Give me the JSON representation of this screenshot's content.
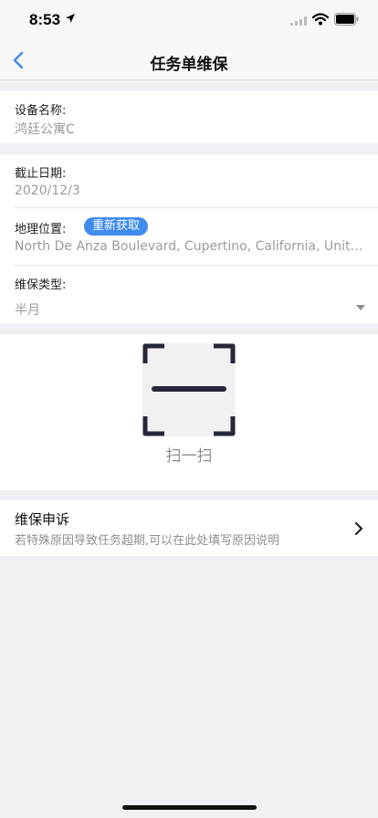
{
  "status_bar": {
    "time": "8:53",
    "icons": [
      "location-arrow-icon",
      "signal-icon",
      "wifi-icon",
      "battery-icon"
    ]
  },
  "nav": {
    "title": "任务单维保",
    "back_icon": "chevron-left-icon"
  },
  "device": {
    "label": "设备名称:",
    "value": "鸿廷公寓C"
  },
  "deadline": {
    "label": "截止日期:",
    "value": "2020/12/3"
  },
  "location": {
    "label": "地理位置:",
    "refresh_label": "重新获取",
    "value": "North De Anza Boulevard, Cupertino, California, United S..."
  },
  "maintenance_type": {
    "label": "维保类型:",
    "value": "半月",
    "icon": "caret-down-icon"
  },
  "scan": {
    "label": "扫一扫",
    "icon": "scan-frame-icon"
  },
  "appeal": {
    "title": "维保申诉",
    "description": "若特殊原因导致任务超期,可以在此处填写原因说明",
    "icon": "chevron-right-icon"
  },
  "colors": {
    "accent": "#3f8bf0",
    "background": "#efeff4",
    "muted_text": "#9b9b9b"
  }
}
